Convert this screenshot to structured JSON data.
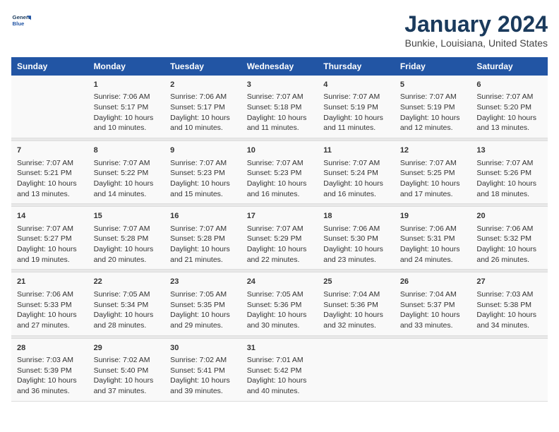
{
  "logo": {
    "line1": "General",
    "line2": "Blue"
  },
  "title": "January 2024",
  "subtitle": "Bunkie, Louisiana, United States",
  "headers": [
    "Sunday",
    "Monday",
    "Tuesday",
    "Wednesday",
    "Thursday",
    "Friday",
    "Saturday"
  ],
  "weeks": [
    [
      {
        "day": "",
        "sunrise": "",
        "sunset": "",
        "daylight": ""
      },
      {
        "day": "1",
        "sunrise": "Sunrise: 7:06 AM",
        "sunset": "Sunset: 5:17 PM",
        "daylight": "Daylight: 10 hours and 10 minutes."
      },
      {
        "day": "2",
        "sunrise": "Sunrise: 7:06 AM",
        "sunset": "Sunset: 5:17 PM",
        "daylight": "Daylight: 10 hours and 10 minutes."
      },
      {
        "day": "3",
        "sunrise": "Sunrise: 7:07 AM",
        "sunset": "Sunset: 5:18 PM",
        "daylight": "Daylight: 10 hours and 11 minutes."
      },
      {
        "day": "4",
        "sunrise": "Sunrise: 7:07 AM",
        "sunset": "Sunset: 5:19 PM",
        "daylight": "Daylight: 10 hours and 11 minutes."
      },
      {
        "day": "5",
        "sunrise": "Sunrise: 7:07 AM",
        "sunset": "Sunset: 5:19 PM",
        "daylight": "Daylight: 10 hours and 12 minutes."
      },
      {
        "day": "6",
        "sunrise": "Sunrise: 7:07 AM",
        "sunset": "Sunset: 5:20 PM",
        "daylight": "Daylight: 10 hours and 13 minutes."
      }
    ],
    [
      {
        "day": "7",
        "sunrise": "Sunrise: 7:07 AM",
        "sunset": "Sunset: 5:21 PM",
        "daylight": "Daylight: 10 hours and 13 minutes."
      },
      {
        "day": "8",
        "sunrise": "Sunrise: 7:07 AM",
        "sunset": "Sunset: 5:22 PM",
        "daylight": "Daylight: 10 hours and 14 minutes."
      },
      {
        "day": "9",
        "sunrise": "Sunrise: 7:07 AM",
        "sunset": "Sunset: 5:23 PM",
        "daylight": "Daylight: 10 hours and 15 minutes."
      },
      {
        "day": "10",
        "sunrise": "Sunrise: 7:07 AM",
        "sunset": "Sunset: 5:23 PM",
        "daylight": "Daylight: 10 hours and 16 minutes."
      },
      {
        "day": "11",
        "sunrise": "Sunrise: 7:07 AM",
        "sunset": "Sunset: 5:24 PM",
        "daylight": "Daylight: 10 hours and 16 minutes."
      },
      {
        "day": "12",
        "sunrise": "Sunrise: 7:07 AM",
        "sunset": "Sunset: 5:25 PM",
        "daylight": "Daylight: 10 hours and 17 minutes."
      },
      {
        "day": "13",
        "sunrise": "Sunrise: 7:07 AM",
        "sunset": "Sunset: 5:26 PM",
        "daylight": "Daylight: 10 hours and 18 minutes."
      }
    ],
    [
      {
        "day": "14",
        "sunrise": "Sunrise: 7:07 AM",
        "sunset": "Sunset: 5:27 PM",
        "daylight": "Daylight: 10 hours and 19 minutes."
      },
      {
        "day": "15",
        "sunrise": "Sunrise: 7:07 AM",
        "sunset": "Sunset: 5:28 PM",
        "daylight": "Daylight: 10 hours and 20 minutes."
      },
      {
        "day": "16",
        "sunrise": "Sunrise: 7:07 AM",
        "sunset": "Sunset: 5:28 PM",
        "daylight": "Daylight: 10 hours and 21 minutes."
      },
      {
        "day": "17",
        "sunrise": "Sunrise: 7:07 AM",
        "sunset": "Sunset: 5:29 PM",
        "daylight": "Daylight: 10 hours and 22 minutes."
      },
      {
        "day": "18",
        "sunrise": "Sunrise: 7:06 AM",
        "sunset": "Sunset: 5:30 PM",
        "daylight": "Daylight: 10 hours and 23 minutes."
      },
      {
        "day": "19",
        "sunrise": "Sunrise: 7:06 AM",
        "sunset": "Sunset: 5:31 PM",
        "daylight": "Daylight: 10 hours and 24 minutes."
      },
      {
        "day": "20",
        "sunrise": "Sunrise: 7:06 AM",
        "sunset": "Sunset: 5:32 PM",
        "daylight": "Daylight: 10 hours and 26 minutes."
      }
    ],
    [
      {
        "day": "21",
        "sunrise": "Sunrise: 7:06 AM",
        "sunset": "Sunset: 5:33 PM",
        "daylight": "Daylight: 10 hours and 27 minutes."
      },
      {
        "day": "22",
        "sunrise": "Sunrise: 7:05 AM",
        "sunset": "Sunset: 5:34 PM",
        "daylight": "Daylight: 10 hours and 28 minutes."
      },
      {
        "day": "23",
        "sunrise": "Sunrise: 7:05 AM",
        "sunset": "Sunset: 5:35 PM",
        "daylight": "Daylight: 10 hours and 29 minutes."
      },
      {
        "day": "24",
        "sunrise": "Sunrise: 7:05 AM",
        "sunset": "Sunset: 5:36 PM",
        "daylight": "Daylight: 10 hours and 30 minutes."
      },
      {
        "day": "25",
        "sunrise": "Sunrise: 7:04 AM",
        "sunset": "Sunset: 5:36 PM",
        "daylight": "Daylight: 10 hours and 32 minutes."
      },
      {
        "day": "26",
        "sunrise": "Sunrise: 7:04 AM",
        "sunset": "Sunset: 5:37 PM",
        "daylight": "Daylight: 10 hours and 33 minutes."
      },
      {
        "day": "27",
        "sunrise": "Sunrise: 7:03 AM",
        "sunset": "Sunset: 5:38 PM",
        "daylight": "Daylight: 10 hours and 34 minutes."
      }
    ],
    [
      {
        "day": "28",
        "sunrise": "Sunrise: 7:03 AM",
        "sunset": "Sunset: 5:39 PM",
        "daylight": "Daylight: 10 hours and 36 minutes."
      },
      {
        "day": "29",
        "sunrise": "Sunrise: 7:02 AM",
        "sunset": "Sunset: 5:40 PM",
        "daylight": "Daylight: 10 hours and 37 minutes."
      },
      {
        "day": "30",
        "sunrise": "Sunrise: 7:02 AM",
        "sunset": "Sunset: 5:41 PM",
        "daylight": "Daylight: 10 hours and 39 minutes."
      },
      {
        "day": "31",
        "sunrise": "Sunrise: 7:01 AM",
        "sunset": "Sunset: 5:42 PM",
        "daylight": "Daylight: 10 hours and 40 minutes."
      },
      {
        "day": "",
        "sunrise": "",
        "sunset": "",
        "daylight": ""
      },
      {
        "day": "",
        "sunrise": "",
        "sunset": "",
        "daylight": ""
      },
      {
        "day": "",
        "sunrise": "",
        "sunset": "",
        "daylight": ""
      }
    ]
  ]
}
